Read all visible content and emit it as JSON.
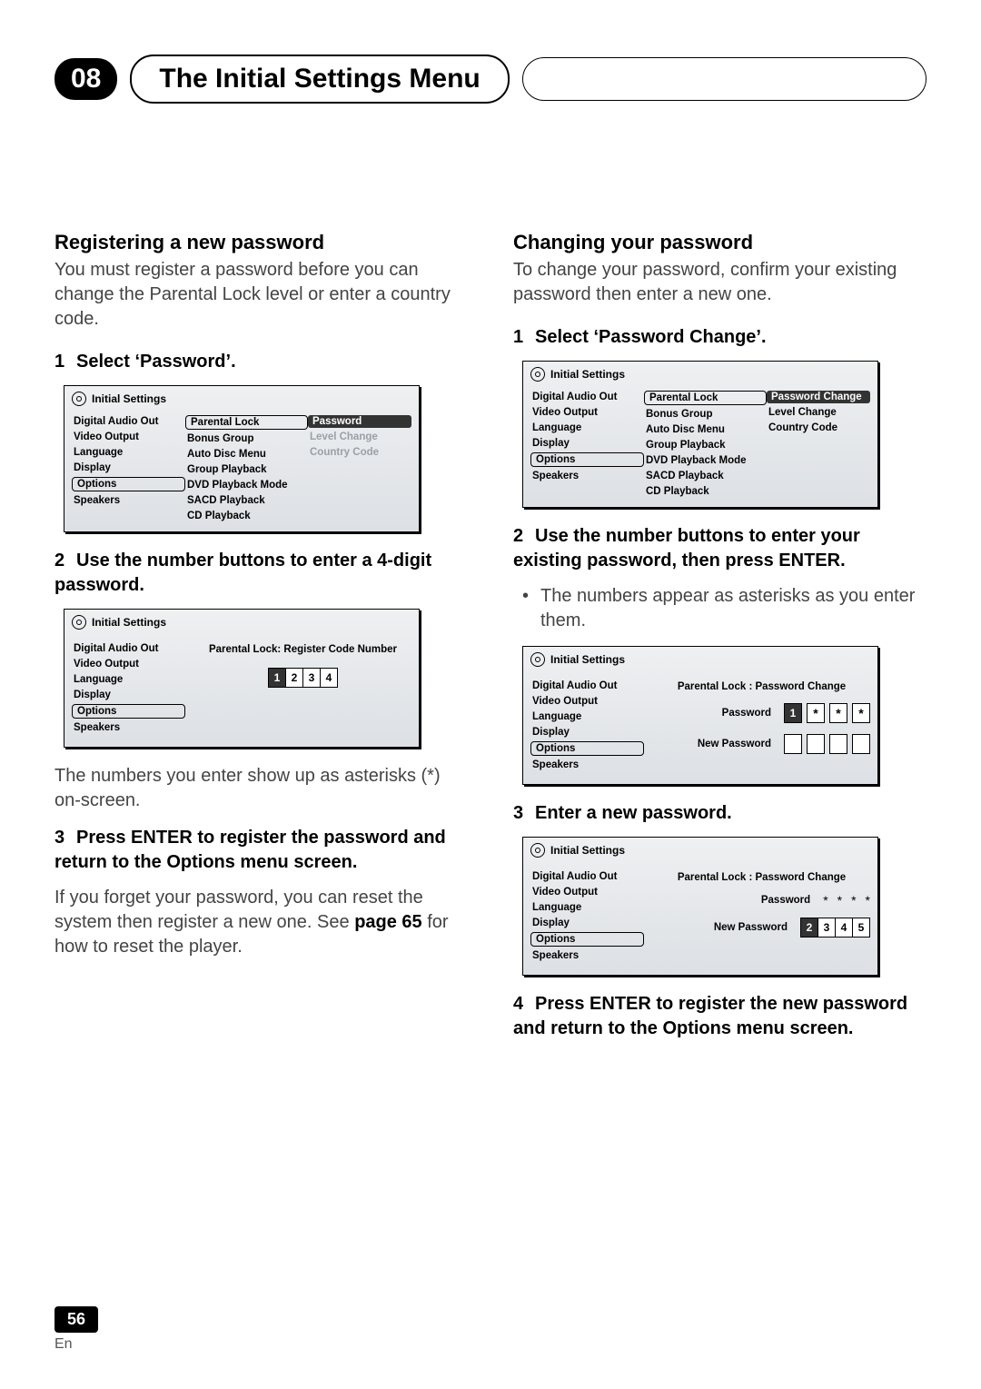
{
  "chapter": "08",
  "title": "The Initial Settings Menu",
  "sectionA": {
    "heading": "Registering a new password",
    "intro": "You must register a password before you can change the Parental Lock level or enter a country code.",
    "step1": "Select ‘Password’.",
    "step2": "Use the number buttons to enter a 4-digit password.",
    "afterStep2": "The numbers you enter show up as asterisks (*) on-screen.",
    "step3": "Press ENTER to register the password and return to the Options menu screen.",
    "afterStep3a": "If you forget your password, you can reset the system then register a new one. See ",
    "afterStep3b": "page 65",
    "afterStep3c": " for how to reset the player."
  },
  "sectionB": {
    "heading": "Changing your password",
    "intro": "To change your password, confirm your existing password then enter a new one.",
    "step1": "Select ‘Password Change’.",
    "step2": "Use the number buttons to enter your existing password, then press ENTER.",
    "bullet2": "The numbers appear as asterisks as you enter them.",
    "step3": "Enter a new password.",
    "step4": "Press ENTER to register the new password and return to the Options menu screen."
  },
  "osd": {
    "header": "Initial Settings",
    "left": [
      "Digital Audio Out",
      "Video Output",
      "Language",
      "Display",
      "Options",
      "Speakers"
    ],
    "mid": [
      "Parental Lock",
      "Bonus Group",
      "Auto Disc Menu",
      "Group Playback",
      "DVD Playback Mode",
      "SACD Playback",
      "CD Playback"
    ],
    "rightA": [
      "Password",
      "Level Change",
      "Country Code"
    ],
    "rightB": [
      "Password Change",
      "Level Change",
      "Country Code"
    ],
    "regTitle": "Parental Lock: Register Code Number",
    "regDigits": [
      "1",
      "2",
      "3",
      "4"
    ],
    "pwChangeTitle": "Parental Lock : Password Change",
    "pwLabel": "Password",
    "newPwLabel": "New Password",
    "pwEnterDigits": [
      "1",
      "*",
      "*",
      "*"
    ],
    "newPwDigits": [
      "2",
      "3",
      "4",
      "5"
    ],
    "dots4": [
      "*",
      "*",
      "*",
      "*"
    ]
  },
  "pageNumber": "56",
  "langAbbrev": "En"
}
